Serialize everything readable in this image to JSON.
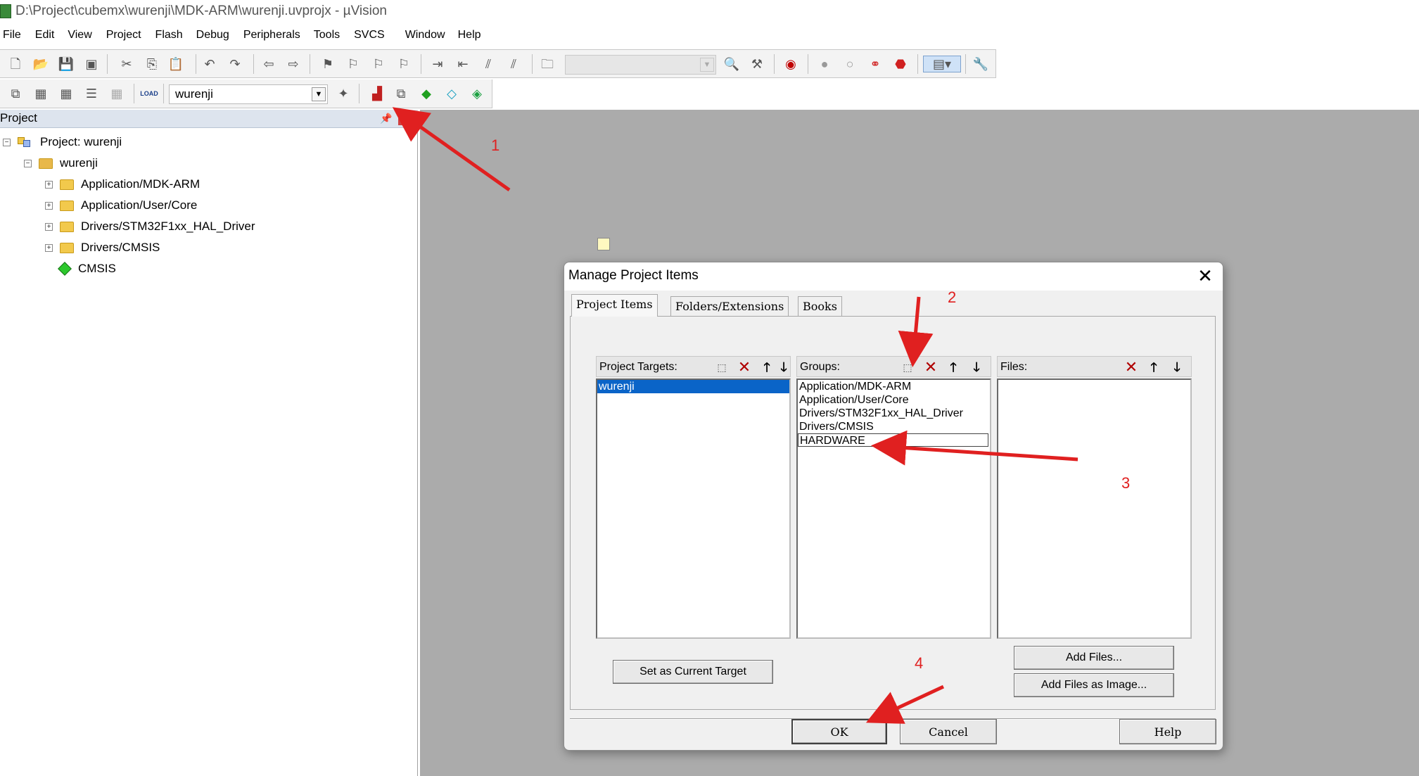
{
  "window": {
    "title": "D:\\Project\\cubemx\\wurenji\\MDK-ARM\\wurenji.uvprojx - µVision"
  },
  "menu": [
    "File",
    "Edit",
    "View",
    "Project",
    "Flash",
    "Debug",
    "Peripherals",
    "Tools",
    "SVCS",
    "Window",
    "Help"
  ],
  "toolbar": {
    "target_select_value": "wurenji",
    "load_label": "LOAD"
  },
  "project_panel": {
    "header": "Project",
    "tree": {
      "root": "Project: wurenji",
      "target": "wurenji",
      "groups": [
        "Application/MDK-ARM",
        "Application/User/Core",
        "Drivers/STM32F1xx_HAL_Driver",
        "Drivers/CMSIS"
      ],
      "component": "CMSIS"
    }
  },
  "dialog": {
    "title": "Manage Project Items",
    "tabs": [
      "Project Items",
      "Folders/Extensions",
      "Books"
    ],
    "targets_label": "Project Targets:",
    "targets": [
      "wurenji"
    ],
    "groups_label": "Groups:",
    "groups": [
      "Application/MDK-ARM",
      "Application/User/Core",
      "Drivers/STM32F1xx_HAL_Driver",
      "Drivers/CMSIS",
      "HARDWARE"
    ],
    "files_label": "Files:",
    "set_current_target": "Set as Current Target",
    "add_files": "Add Files...",
    "add_files_image": "Add Files as Image...",
    "ok": "OK",
    "cancel": "Cancel",
    "help": "Help"
  },
  "annotations": [
    "1",
    "2",
    "3",
    "4"
  ],
  "colors": {
    "accent_selection": "#0a64c8",
    "annotation_red": "#e02020",
    "workspace_gray": "#ababab"
  }
}
